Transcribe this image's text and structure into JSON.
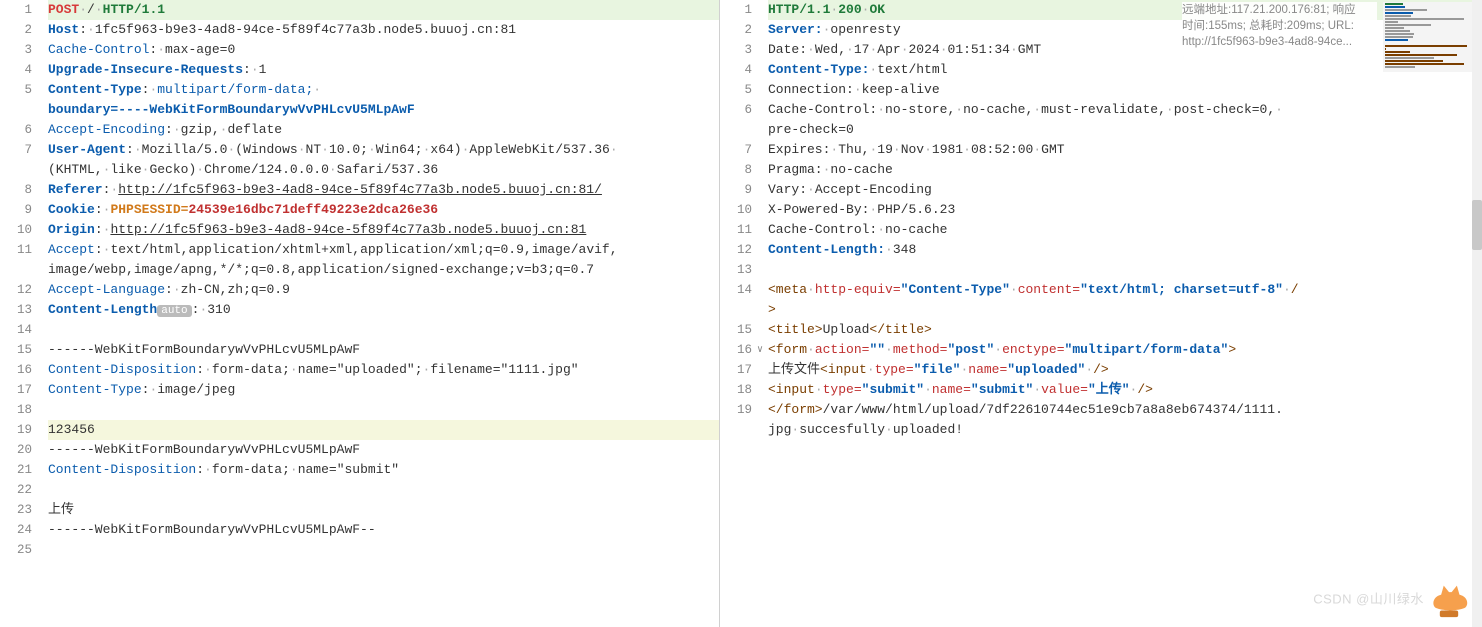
{
  "left": {
    "lines": [
      {
        "n": "1",
        "cls": "hl-first",
        "segs": [
          [
            "method",
            "POST"
          ],
          [
            "dim",
            "·"
          ],
          [
            "plain",
            "/"
          ],
          [
            "dim",
            "·"
          ],
          [
            "proto",
            "HTTP/1.1"
          ]
        ]
      },
      {
        "n": "2",
        "segs": [
          [
            "hdr",
            "Host"
          ],
          [
            "plain",
            ":"
          ],
          [
            "dim",
            "·"
          ],
          [
            "plain",
            "1fc5f963-b9e3-4ad8-94ce-5f89f4c77a3b.node5.buuoj.cn:81"
          ]
        ]
      },
      {
        "n": "3",
        "segs": [
          [
            "hdr-nb",
            "Cache-Control"
          ],
          [
            "plain",
            ":"
          ],
          [
            "dim",
            "·"
          ],
          [
            "plain",
            "max-age=0"
          ]
        ]
      },
      {
        "n": "4",
        "segs": [
          [
            "hdr",
            "Upgrade-Insecure-Requests"
          ],
          [
            "plain",
            ":"
          ],
          [
            "dim",
            "·"
          ],
          [
            "plain",
            "1"
          ]
        ]
      },
      {
        "n": "5",
        "segs": [
          [
            "hdr",
            "Content-Type"
          ],
          [
            "plain",
            ":"
          ],
          [
            "dim",
            "·"
          ],
          [
            "val",
            "multipart/form-data;"
          ],
          [
            "dim",
            "·"
          ]
        ]
      },
      {
        "n": "",
        "segs": [
          [
            "boundary",
            "boundary=----WebKitFormBoundarywVvPHLcvU5MLpAwF"
          ]
        ]
      },
      {
        "n": "6",
        "segs": [
          [
            "hdr-nb",
            "Accept-Encoding"
          ],
          [
            "plain",
            ":"
          ],
          [
            "dim",
            "·"
          ],
          [
            "plain",
            "gzip,"
          ],
          [
            "dim",
            "·"
          ],
          [
            "plain",
            "deflate"
          ]
        ]
      },
      {
        "n": "7",
        "segs": [
          [
            "hdr",
            "User-Agent"
          ],
          [
            "plain",
            ":"
          ],
          [
            "dim",
            "·"
          ],
          [
            "plain",
            "Mozilla/5.0"
          ],
          [
            "dim",
            "·"
          ],
          [
            "plain",
            "(Windows"
          ],
          [
            "dim",
            "·"
          ],
          [
            "plain",
            "NT"
          ],
          [
            "dim",
            "·"
          ],
          [
            "plain",
            "10.0;"
          ],
          [
            "dim",
            "·"
          ],
          [
            "plain",
            "Win64;"
          ],
          [
            "dim",
            "·"
          ],
          [
            "plain",
            "x64)"
          ],
          [
            "dim",
            "·"
          ],
          [
            "plain",
            "AppleWebKit/537.36"
          ],
          [
            "dim",
            "·"
          ]
        ]
      },
      {
        "n": "",
        "segs": [
          [
            "plain",
            "(KHTML,"
          ],
          [
            "dim",
            "·"
          ],
          [
            "plain",
            "like"
          ],
          [
            "dim",
            "·"
          ],
          [
            "plain",
            "Gecko)"
          ],
          [
            "dim",
            "·"
          ],
          [
            "plain",
            "Chrome/124.0.0.0"
          ],
          [
            "dim",
            "·"
          ],
          [
            "plain",
            "Safari/537.36"
          ]
        ]
      },
      {
        "n": "8",
        "segs": [
          [
            "hdr",
            "Referer"
          ],
          [
            "plain",
            ":"
          ],
          [
            "dim",
            "·"
          ],
          [
            "url",
            "http://1fc5f963-b9e3-4ad8-94ce-5f89f4c77a3b.node5.buuoj.cn:81/"
          ]
        ]
      },
      {
        "n": "9",
        "segs": [
          [
            "hdr",
            "Cookie"
          ],
          [
            "plain",
            ":"
          ],
          [
            "dim",
            "·"
          ],
          [
            "sess",
            "PHPSESSID="
          ],
          [
            "sessval",
            "24539e16dbc71deff49223e2dca26e36"
          ]
        ]
      },
      {
        "n": "10",
        "segs": [
          [
            "hdr",
            "Origin"
          ],
          [
            "plain",
            ":"
          ],
          [
            "dim",
            "·"
          ],
          [
            "url",
            "http://1fc5f963-b9e3-4ad8-94ce-5f89f4c77a3b.node5.buuoj.cn:81"
          ]
        ]
      },
      {
        "n": "11",
        "segs": [
          [
            "hdr-nb",
            "Accept"
          ],
          [
            "plain",
            ":"
          ],
          [
            "dim",
            "·"
          ],
          [
            "plain",
            "text/html,application/xhtml+xml,application/xml;q=0.9,image/avif,"
          ]
        ]
      },
      {
        "n": "",
        "segs": [
          [
            "plain",
            "image/webp,image/apng,*/*;q=0.8,application/signed-exchange;v=b3;q=0.7"
          ]
        ]
      },
      {
        "n": "12",
        "segs": [
          [
            "hdr-nb",
            "Accept-Language"
          ],
          [
            "plain",
            ":"
          ],
          [
            "dim",
            "·"
          ],
          [
            "plain",
            "zh-CN,zh;q=0.9"
          ]
        ]
      },
      {
        "n": "13",
        "segs": [
          [
            "hdr",
            "Content-Length"
          ],
          [
            "badge",
            "auto"
          ],
          [
            "plain",
            ":"
          ],
          [
            "dim",
            "·"
          ],
          [
            "plain",
            "310"
          ]
        ]
      },
      {
        "n": "14",
        "segs": []
      },
      {
        "n": "15",
        "segs": [
          [
            "plain",
            "------WebKitFormBoundarywVvPHLcvU5MLpAwF"
          ]
        ]
      },
      {
        "n": "16",
        "segs": [
          [
            "hdr-nb",
            "Content-Disposition"
          ],
          [
            "plain",
            ":"
          ],
          [
            "dim",
            "·"
          ],
          [
            "plain",
            "form-data;"
          ],
          [
            "dim",
            "·"
          ],
          [
            "plain",
            "name=\"uploaded\";"
          ],
          [
            "dim",
            "·"
          ],
          [
            "plain",
            "filename=\"1111.jpg\""
          ]
        ]
      },
      {
        "n": "17",
        "segs": [
          [
            "hdr-nb",
            "Content-Type"
          ],
          [
            "plain",
            ":"
          ],
          [
            "dim",
            "·"
          ],
          [
            "plain",
            "image/jpeg"
          ]
        ]
      },
      {
        "n": "18",
        "segs": []
      },
      {
        "n": "19",
        "cls": "hl-line",
        "segs": [
          [
            "plain",
            "123456"
          ]
        ]
      },
      {
        "n": "20",
        "segs": [
          [
            "plain",
            "------WebKitFormBoundarywVvPHLcvU5MLpAwF"
          ]
        ]
      },
      {
        "n": "21",
        "segs": [
          [
            "hdr-nb",
            "Content-Disposition"
          ],
          [
            "plain",
            ":"
          ],
          [
            "dim",
            "·"
          ],
          [
            "plain",
            "form-data;"
          ],
          [
            "dim",
            "·"
          ],
          [
            "plain",
            "name=\"submit\""
          ]
        ]
      },
      {
        "n": "22",
        "segs": []
      },
      {
        "n": "23",
        "segs": [
          [
            "plain",
            "上传"
          ]
        ]
      },
      {
        "n": "24",
        "segs": [
          [
            "plain",
            "------WebKitFormBoundarywVvPHLcvU5MLpAwF--"
          ]
        ]
      },
      {
        "n": "25",
        "segs": []
      }
    ]
  },
  "right": {
    "info": {
      "l1": "远端地址:117.21.200.176:81; 响应",
      "l2": "时间:155ms; 总耗时:209ms; URL:",
      "l3": "http://1fc5f963-b9e3-4ad8-94ce..."
    },
    "lines": [
      {
        "n": "1",
        "cls": "hl-first",
        "segs": [
          [
            "proto",
            "HTTP/1.1"
          ],
          [
            "dim",
            "·"
          ],
          [
            "proto",
            "200"
          ],
          [
            "dim",
            "·"
          ],
          [
            "proto",
            "OK"
          ]
        ]
      },
      {
        "n": "2",
        "segs": [
          [
            "hdr",
            "Server:"
          ],
          [
            "dim",
            "·"
          ],
          [
            "plain",
            "openresty"
          ]
        ]
      },
      {
        "n": "3",
        "segs": [
          [
            "plain",
            "Date:"
          ],
          [
            "dim",
            "·"
          ],
          [
            "plain",
            "Wed,"
          ],
          [
            "dim",
            "·"
          ],
          [
            "plain",
            "17"
          ],
          [
            "dim",
            "·"
          ],
          [
            "plain",
            "Apr"
          ],
          [
            "dim",
            "·"
          ],
          [
            "plain",
            "2024"
          ],
          [
            "dim",
            "·"
          ],
          [
            "plain",
            "01:51:34"
          ],
          [
            "dim",
            "·"
          ],
          [
            "plain",
            "GMT"
          ]
        ]
      },
      {
        "n": "4",
        "segs": [
          [
            "hdr",
            "Content-Type:"
          ],
          [
            "dim",
            "·"
          ],
          [
            "plain",
            "text/html"
          ]
        ]
      },
      {
        "n": "5",
        "segs": [
          [
            "plain",
            "Connection:"
          ],
          [
            "dim",
            "·"
          ],
          [
            "plain",
            "keep-alive"
          ]
        ]
      },
      {
        "n": "6",
        "segs": [
          [
            "plain",
            "Cache-Control:"
          ],
          [
            "dim",
            "·"
          ],
          [
            "plain",
            "no-store,"
          ],
          [
            "dim",
            "·"
          ],
          [
            "plain",
            "no-cache,"
          ],
          [
            "dim",
            "·"
          ],
          [
            "plain",
            "must-revalidate,"
          ],
          [
            "dim",
            "·"
          ],
          [
            "plain",
            "post-check=0,"
          ],
          [
            "dim",
            "·"
          ]
        ]
      },
      {
        "n": "",
        "segs": [
          [
            "plain",
            "pre-check=0"
          ]
        ]
      },
      {
        "n": "7",
        "segs": [
          [
            "plain",
            "Expires:"
          ],
          [
            "dim",
            "·"
          ],
          [
            "plain",
            "Thu,"
          ],
          [
            "dim",
            "·"
          ],
          [
            "plain",
            "19"
          ],
          [
            "dim",
            "·"
          ],
          [
            "plain",
            "Nov"
          ],
          [
            "dim",
            "·"
          ],
          [
            "plain",
            "1981"
          ],
          [
            "dim",
            "·"
          ],
          [
            "plain",
            "08:52:00"
          ],
          [
            "dim",
            "·"
          ],
          [
            "plain",
            "GMT"
          ]
        ]
      },
      {
        "n": "8",
        "segs": [
          [
            "plain",
            "Pragma:"
          ],
          [
            "dim",
            "·"
          ],
          [
            "plain",
            "no-cache"
          ]
        ]
      },
      {
        "n": "9",
        "segs": [
          [
            "plain",
            "Vary:"
          ],
          [
            "dim",
            "·"
          ],
          [
            "plain",
            "Accept-Encoding"
          ]
        ]
      },
      {
        "n": "10",
        "segs": [
          [
            "plain",
            "X-Powered-By:"
          ],
          [
            "dim",
            "·"
          ],
          [
            "plain",
            "PHP/5.6.23"
          ]
        ]
      },
      {
        "n": "11",
        "segs": [
          [
            "plain",
            "Cache-Control:"
          ],
          [
            "dim",
            "·"
          ],
          [
            "plain",
            "no-cache"
          ]
        ]
      },
      {
        "n": "12",
        "segs": [
          [
            "hdr",
            "Content-Length:"
          ],
          [
            "dim",
            "·"
          ],
          [
            "plain",
            "348"
          ]
        ]
      },
      {
        "n": "13",
        "segs": []
      },
      {
        "n": "14",
        "segs": [
          [
            "tag",
            "<meta"
          ],
          [
            "dim",
            "·"
          ],
          [
            "attr",
            "http-equiv="
          ],
          [
            "aval",
            "\"Content-Type\""
          ],
          [
            "dim",
            "·"
          ],
          [
            "attr",
            "content="
          ],
          [
            "aval",
            "\"text/html; charset=utf-8\""
          ],
          [
            "dim",
            "·"
          ],
          [
            "tag",
            "/"
          ]
        ]
      },
      {
        "n": "",
        "segs": [
          [
            "tag",
            ">"
          ]
        ]
      },
      {
        "n": "15",
        "segs": [
          [
            "tag",
            "<title>"
          ],
          [
            "txt",
            "Upload"
          ],
          [
            "tag",
            "</title>"
          ]
        ]
      },
      {
        "n": "16",
        "fold": true,
        "segs": [
          [
            "tag",
            "<form"
          ],
          [
            "dim",
            "·"
          ],
          [
            "attr",
            "action="
          ],
          [
            "aval",
            "\"\""
          ],
          [
            "dim",
            "·"
          ],
          [
            "attr",
            "method="
          ],
          [
            "aval",
            "\"post\""
          ],
          [
            "dim",
            "·"
          ],
          [
            "attr",
            "enctype="
          ],
          [
            "aval",
            "\"multipart/form-data\""
          ],
          [
            "tag",
            ">"
          ]
        ]
      },
      {
        "n": "17",
        "segs": [
          [
            "txt",
            "上传文件"
          ],
          [
            "tag",
            "<input"
          ],
          [
            "dim",
            "·"
          ],
          [
            "attr",
            "type="
          ],
          [
            "aval",
            "\"file\""
          ],
          [
            "dim",
            "·"
          ],
          [
            "attr",
            "name="
          ],
          [
            "aval",
            "\"uploaded\""
          ],
          [
            "dim",
            "·"
          ],
          [
            "tag",
            "/>"
          ]
        ]
      },
      {
        "n": "18",
        "segs": [
          [
            "tag",
            "<input"
          ],
          [
            "dim",
            "·"
          ],
          [
            "attr",
            "type="
          ],
          [
            "aval",
            "\"submit\""
          ],
          [
            "dim",
            "·"
          ],
          [
            "attr",
            "name="
          ],
          [
            "aval",
            "\"submit\""
          ],
          [
            "dim",
            "·"
          ],
          [
            "attr",
            "value="
          ],
          [
            "aval",
            "\"上传\""
          ],
          [
            "dim",
            "·"
          ],
          [
            "tag",
            "/>"
          ]
        ]
      },
      {
        "n": "19",
        "segs": [
          [
            "tag",
            "</form>"
          ],
          [
            "txt",
            "/var/www/html/upload/7df22610744ec51e9cb7a8a8eb674374/1111."
          ]
        ]
      },
      {
        "n": "",
        "segs": [
          [
            "txt",
            "jpg"
          ],
          [
            "dim",
            "·"
          ],
          [
            "txt",
            "succesfully"
          ],
          [
            "dim",
            "·"
          ],
          [
            "txt",
            "uploaded!"
          ]
        ]
      }
    ]
  },
  "watermark": "CSDN @山川绿水"
}
